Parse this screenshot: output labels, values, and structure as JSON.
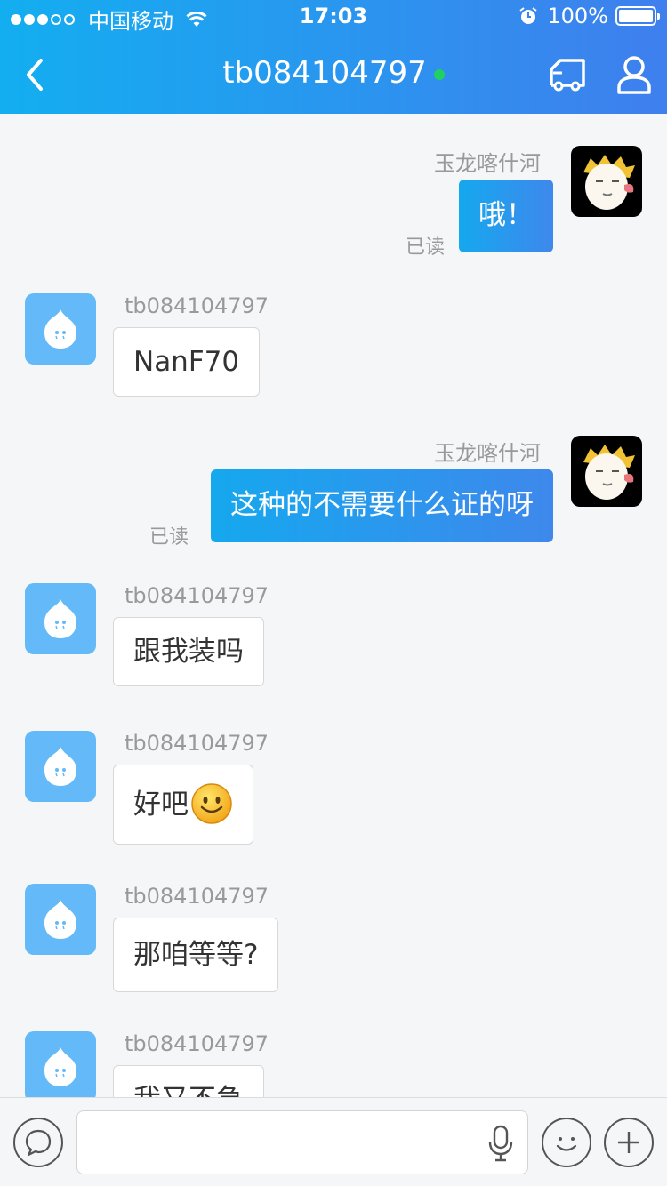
{
  "status_bar": {
    "carrier": "中国移动",
    "time": "17:03",
    "battery": "100%",
    "battery_level": 1.0
  },
  "header": {
    "title": "tb084104797",
    "online_color": "#1fd15f",
    "gradient_from": "#13aef0",
    "gradient_to": "#3f7fee"
  },
  "messages": [
    {
      "from": "self",
      "sender": "玉龙喀什河",
      "text": "哦！",
      "read": "已读"
    },
    {
      "from": "other",
      "sender": "tb084104797",
      "text": "NanF70"
    },
    {
      "from": "self",
      "sender": "玉龙喀什河",
      "text": "这种的不需要什么证的呀",
      "read": "已读"
    },
    {
      "from": "other",
      "sender": "tb084104797",
      "text": "跟我装吗"
    },
    {
      "from": "other",
      "sender": "tb084104797",
      "text": "好吧",
      "emoji": "smile-emoji"
    },
    {
      "from": "other",
      "sender": "tb084104797",
      "text": "那咱等等?"
    },
    {
      "from": "other",
      "sender": "tb084104797",
      "text": "我又不急"
    }
  ],
  "toolbar": {
    "input_value": "",
    "icons": [
      "chat-bubble-icon",
      "microphone-icon",
      "smiley-icon",
      "plus-icon"
    ]
  }
}
